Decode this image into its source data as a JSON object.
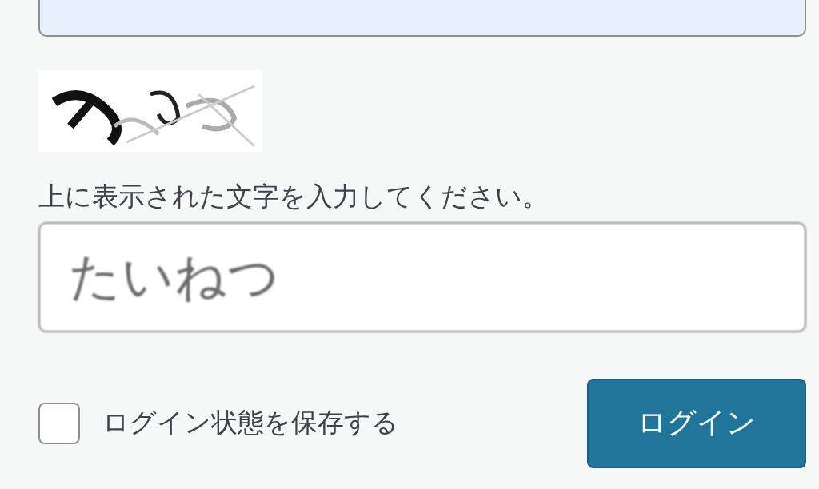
{
  "upper_field": {
    "autofilled": true
  },
  "captcha_label": "上に表示された文字を入力してください。",
  "captcha_input": {
    "value": "たいねつ"
  },
  "remember": {
    "label": "ログイン状態を保存する",
    "checked": false
  },
  "login_button": {
    "label": "ログイン"
  }
}
